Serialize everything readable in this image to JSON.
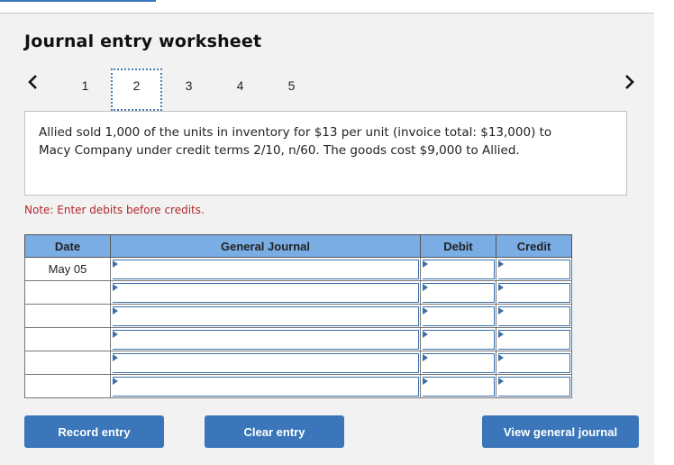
{
  "header": {
    "title": "Journal entry worksheet"
  },
  "pager": {
    "prev_icon": "‹",
    "next_icon": "›",
    "pages": [
      "1",
      "2",
      "3",
      "4",
      "5"
    ],
    "active_page": "2"
  },
  "question": {
    "text": "Allied sold 1,000 of the units in inventory for $13 per unit (invoice total: $13,000) to Macy Company under credit terms 2/10, n/60. The goods cost $9,000 to Allied."
  },
  "note": "Note: Enter debits before credits.",
  "journal": {
    "columns": [
      "Date",
      "General Journal",
      "Debit",
      "Credit"
    ],
    "rows": [
      {
        "date": "May 05",
        "account": "",
        "debit": "",
        "credit": ""
      },
      {
        "date": "",
        "account": "",
        "debit": "",
        "credit": ""
      },
      {
        "date": "",
        "account": "",
        "debit": "",
        "credit": ""
      },
      {
        "date": "",
        "account": "",
        "debit": "",
        "credit": ""
      },
      {
        "date": "",
        "account": "",
        "debit": "",
        "credit": ""
      },
      {
        "date": "",
        "account": "",
        "debit": "",
        "credit": ""
      }
    ]
  },
  "buttons": {
    "record": "Record entry",
    "clear": "Clear entry",
    "view": "View general journal"
  },
  "colors": {
    "accent": "#3a76b9",
    "header_bg": "#7aade3",
    "note_red": "#b0272d",
    "panel_bg": "#f2f2f2"
  }
}
